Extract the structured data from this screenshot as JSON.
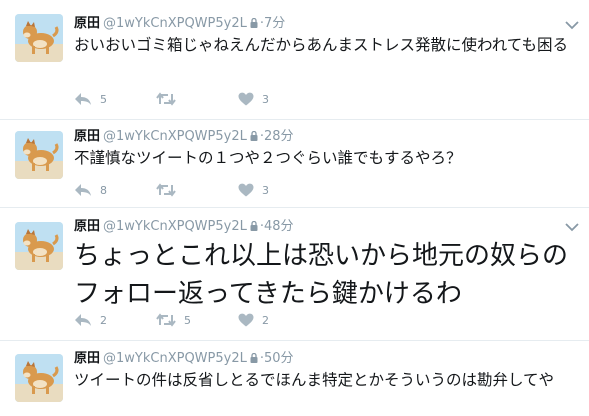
{
  "tweets": [
    {
      "name": "原田",
      "handle": "@1wYkCnXPQWP5y2L",
      "separator": "·",
      "time": "7分",
      "text": "おいおいゴミ箱じゃねえんだからあんまストレス発散に使われても困る",
      "text_size": "small",
      "reply_count": "5",
      "retweet_count": "",
      "like_count": "3"
    },
    {
      "name": "原田",
      "handle": "@1wYkCnXPQWP5y2L",
      "separator": "·",
      "time": "28分",
      "text": "不謹慎なツイートの１つや２つぐらい誰でもするやろ？",
      "text_size": "small",
      "reply_count": "8",
      "retweet_count": "",
      "like_count": "3"
    },
    {
      "name": "原田",
      "handle": "@1wYkCnXPQWP5y2L",
      "separator": "·",
      "time": "48分",
      "text_line1": "ちょっとこれ以上は恐いから地元の奴らの",
      "text_line2": "フォロー返ってきたら鍵かけるわ",
      "text_size": "large",
      "reply_count": "2",
      "retweet_count": "5",
      "like_count": "2"
    },
    {
      "name": "原田",
      "handle": "@1wYkCnXPQWP5y2L",
      "separator": "·",
      "time": "50分",
      "text": "ツイートの件は反省しとるでほんま特定とかそういうのは勘弁してや",
      "text_size": "small"
    }
  ],
  "icons": {
    "reply": "reply-icon",
    "retweet": "retweet-icon",
    "like": "heart-icon",
    "lock": "lock-icon",
    "more": "chevron-down-icon",
    "avatar": "shiba-dog-avatar"
  },
  "colors": {
    "text": "#14171a",
    "muted": "#8899a6",
    "action_icon": "#aab8c2",
    "divider": "#e6ecf0"
  }
}
